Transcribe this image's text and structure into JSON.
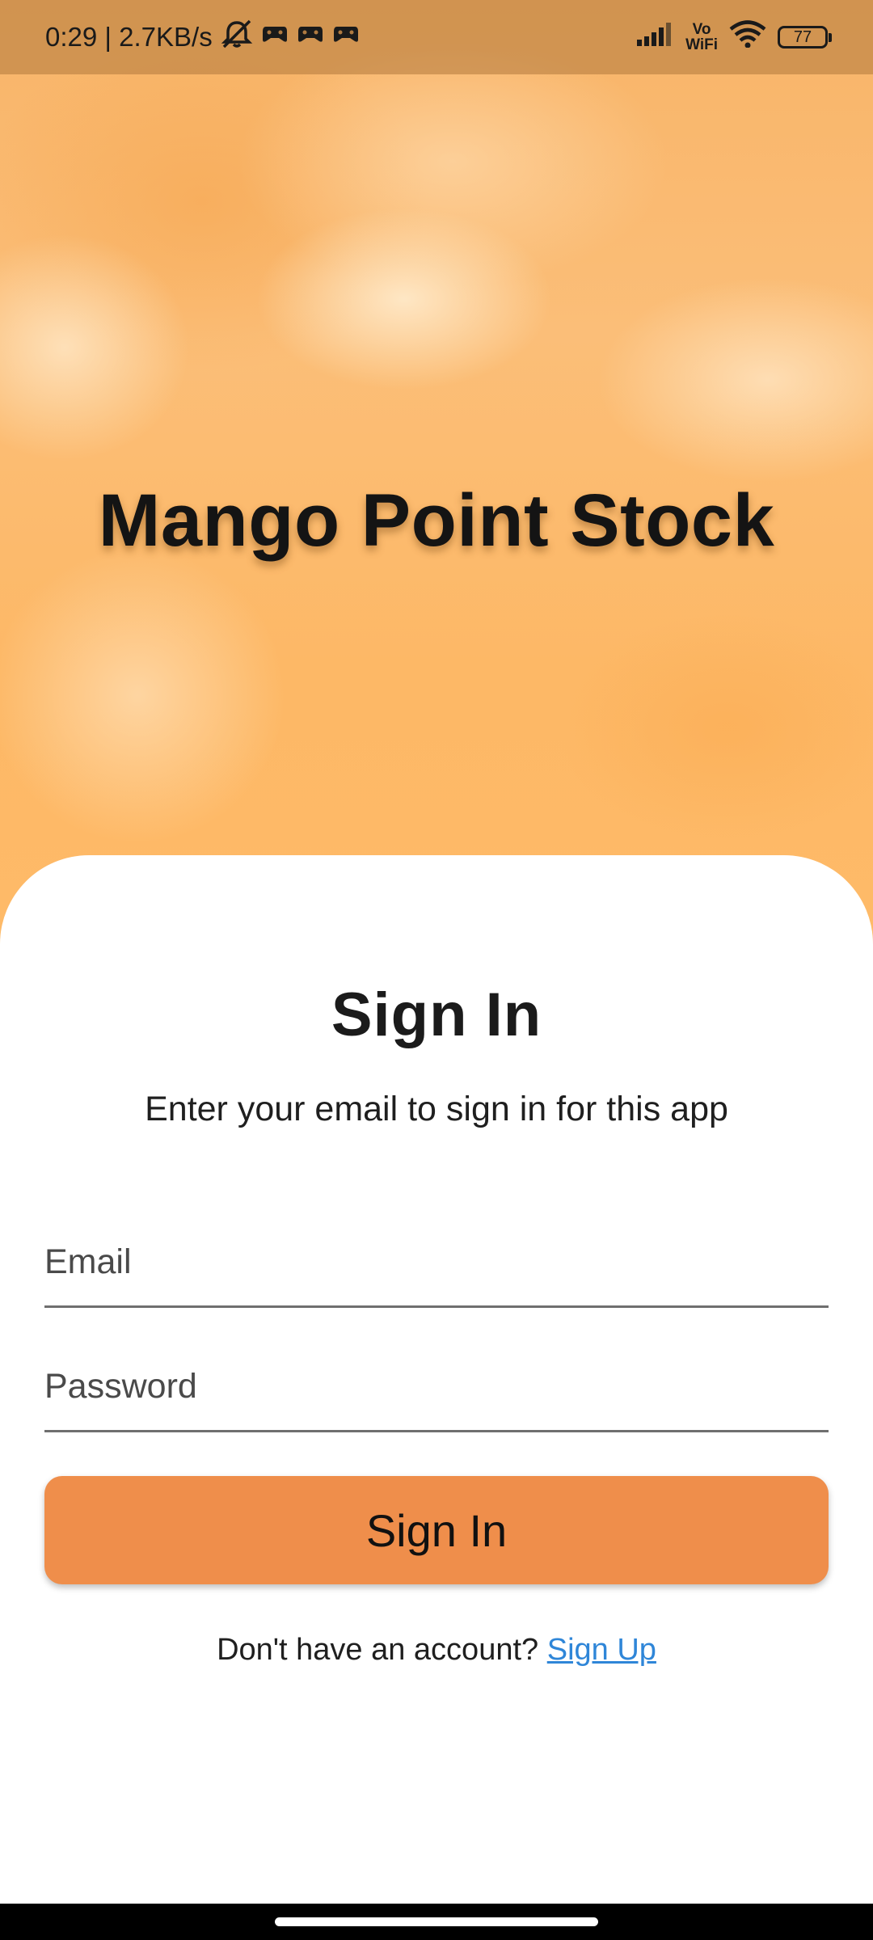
{
  "status_bar": {
    "time_speed": "0:29 | 2.7KB/s",
    "vowifi_top": "Vo",
    "vowifi_bottom": "WiFi",
    "battery": "77",
    "icons": [
      "mute-icon",
      "game-icon",
      "game-icon",
      "game-icon",
      "signal-icon",
      "vowifi-icon",
      "wifi-icon",
      "battery-icon"
    ]
  },
  "hero": {
    "app_title": "Mango Point Stock",
    "background_color": "#fdb866"
  },
  "form": {
    "title": "Sign In",
    "subtitle": "Enter your email to sign in for this app",
    "email_placeholder": "Email",
    "password_placeholder": "Password",
    "submit_label": "Sign In",
    "submit_color": "#ef8e4b",
    "signup_prompt": "Don't have an account?",
    "signup_link": "Sign Up",
    "link_color": "#2f86d8"
  }
}
